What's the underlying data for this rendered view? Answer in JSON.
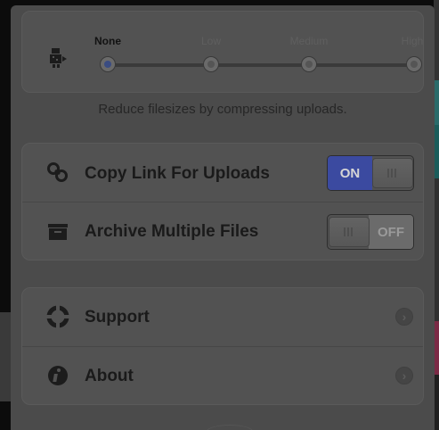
{
  "compression": {
    "levels": [
      "None",
      "Low",
      "Medium",
      "High"
    ],
    "selected": "None",
    "caption": "Reduce filesizes by compressing uploads."
  },
  "toggles": [
    {
      "label": "Copy Link For Uploads",
      "state_text": "ON",
      "on": true,
      "icon": "link-icon"
    },
    {
      "label": "Archive Multiple Files",
      "state_text": "OFF",
      "on": false,
      "icon": "archive-icon"
    }
  ],
  "links": [
    {
      "label": "Support",
      "icon": "lifebuoy-icon"
    },
    {
      "label": "About",
      "icon": "info-icon"
    }
  ],
  "colors": {
    "accent_on": "#3b4aa0",
    "overlay_dim": "#4b4b4b"
  }
}
